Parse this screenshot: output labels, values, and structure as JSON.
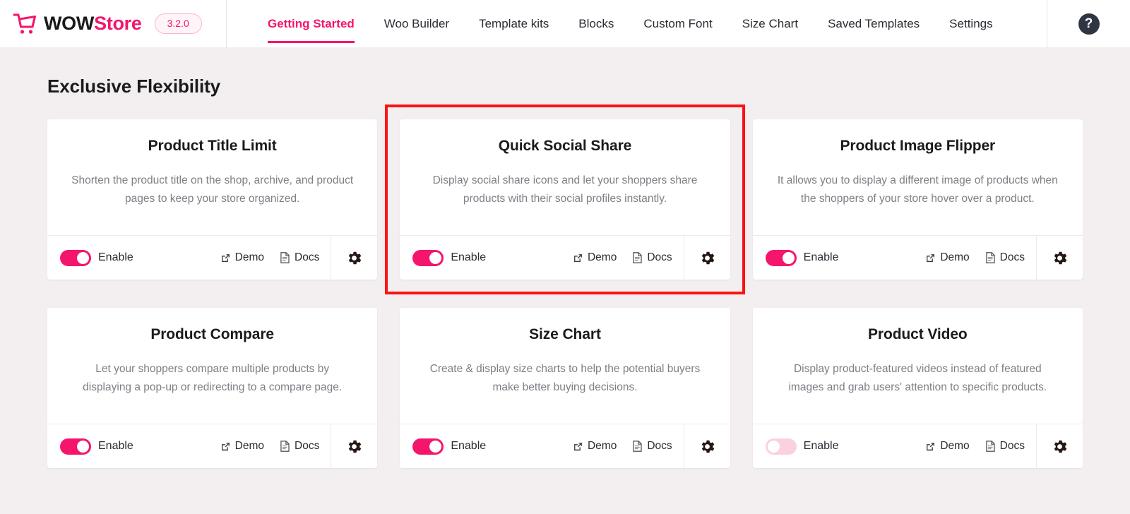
{
  "header": {
    "logo_icon": "shopping-cart-icon",
    "brand_first": "WOW",
    "brand_second": "Store",
    "version": "3.2.0",
    "help_icon": "question-mark-icon",
    "accent_color": "#f5156c",
    "nav": [
      {
        "label": "Getting Started",
        "active": true
      },
      {
        "label": "Woo Builder",
        "active": false
      },
      {
        "label": "Template kits",
        "active": false
      },
      {
        "label": "Blocks",
        "active": false
      },
      {
        "label": "Custom Font",
        "active": false
      },
      {
        "label": "Size Chart",
        "active": false
      },
      {
        "label": "Saved Templates",
        "active": false
      },
      {
        "label": "Settings",
        "active": false
      }
    ]
  },
  "main": {
    "section_title": "Exclusive Flexibility",
    "highlight_color": "#fc1212",
    "labels": {
      "enable": "Enable",
      "demo": "Demo",
      "docs": "Docs",
      "demo_icon": "external-link-icon",
      "docs_icon": "document-icon",
      "settings_icon": "gear-icon"
    },
    "cards": [
      {
        "title": "Product Title Limit",
        "description": "Shorten the product title on the shop, archive, and product pages to keep your store organized.",
        "enabled": true,
        "highlighted": false
      },
      {
        "title": "Quick Social Share",
        "description": "Display social share icons and let your shoppers share products with their social profiles instantly.",
        "enabled": true,
        "highlighted": true
      },
      {
        "title": "Product Image Flipper",
        "description": "It allows you to display a different image of products when the shoppers of your store hover over a product.",
        "enabled": true,
        "highlighted": false
      },
      {
        "title": "Product Compare",
        "description": "Let your shoppers compare multiple products by displaying a pop-up or redirecting to a compare page.",
        "enabled": true,
        "highlighted": false
      },
      {
        "title": "Size Chart",
        "description": "Create & display size charts to help the potential buyers make better buying decisions.",
        "enabled": true,
        "highlighted": false
      },
      {
        "title": "Product Video",
        "description": "Display product-featured videos instead of featured images and grab users' attention to specific products.",
        "enabled": false,
        "highlighted": false
      }
    ]
  }
}
